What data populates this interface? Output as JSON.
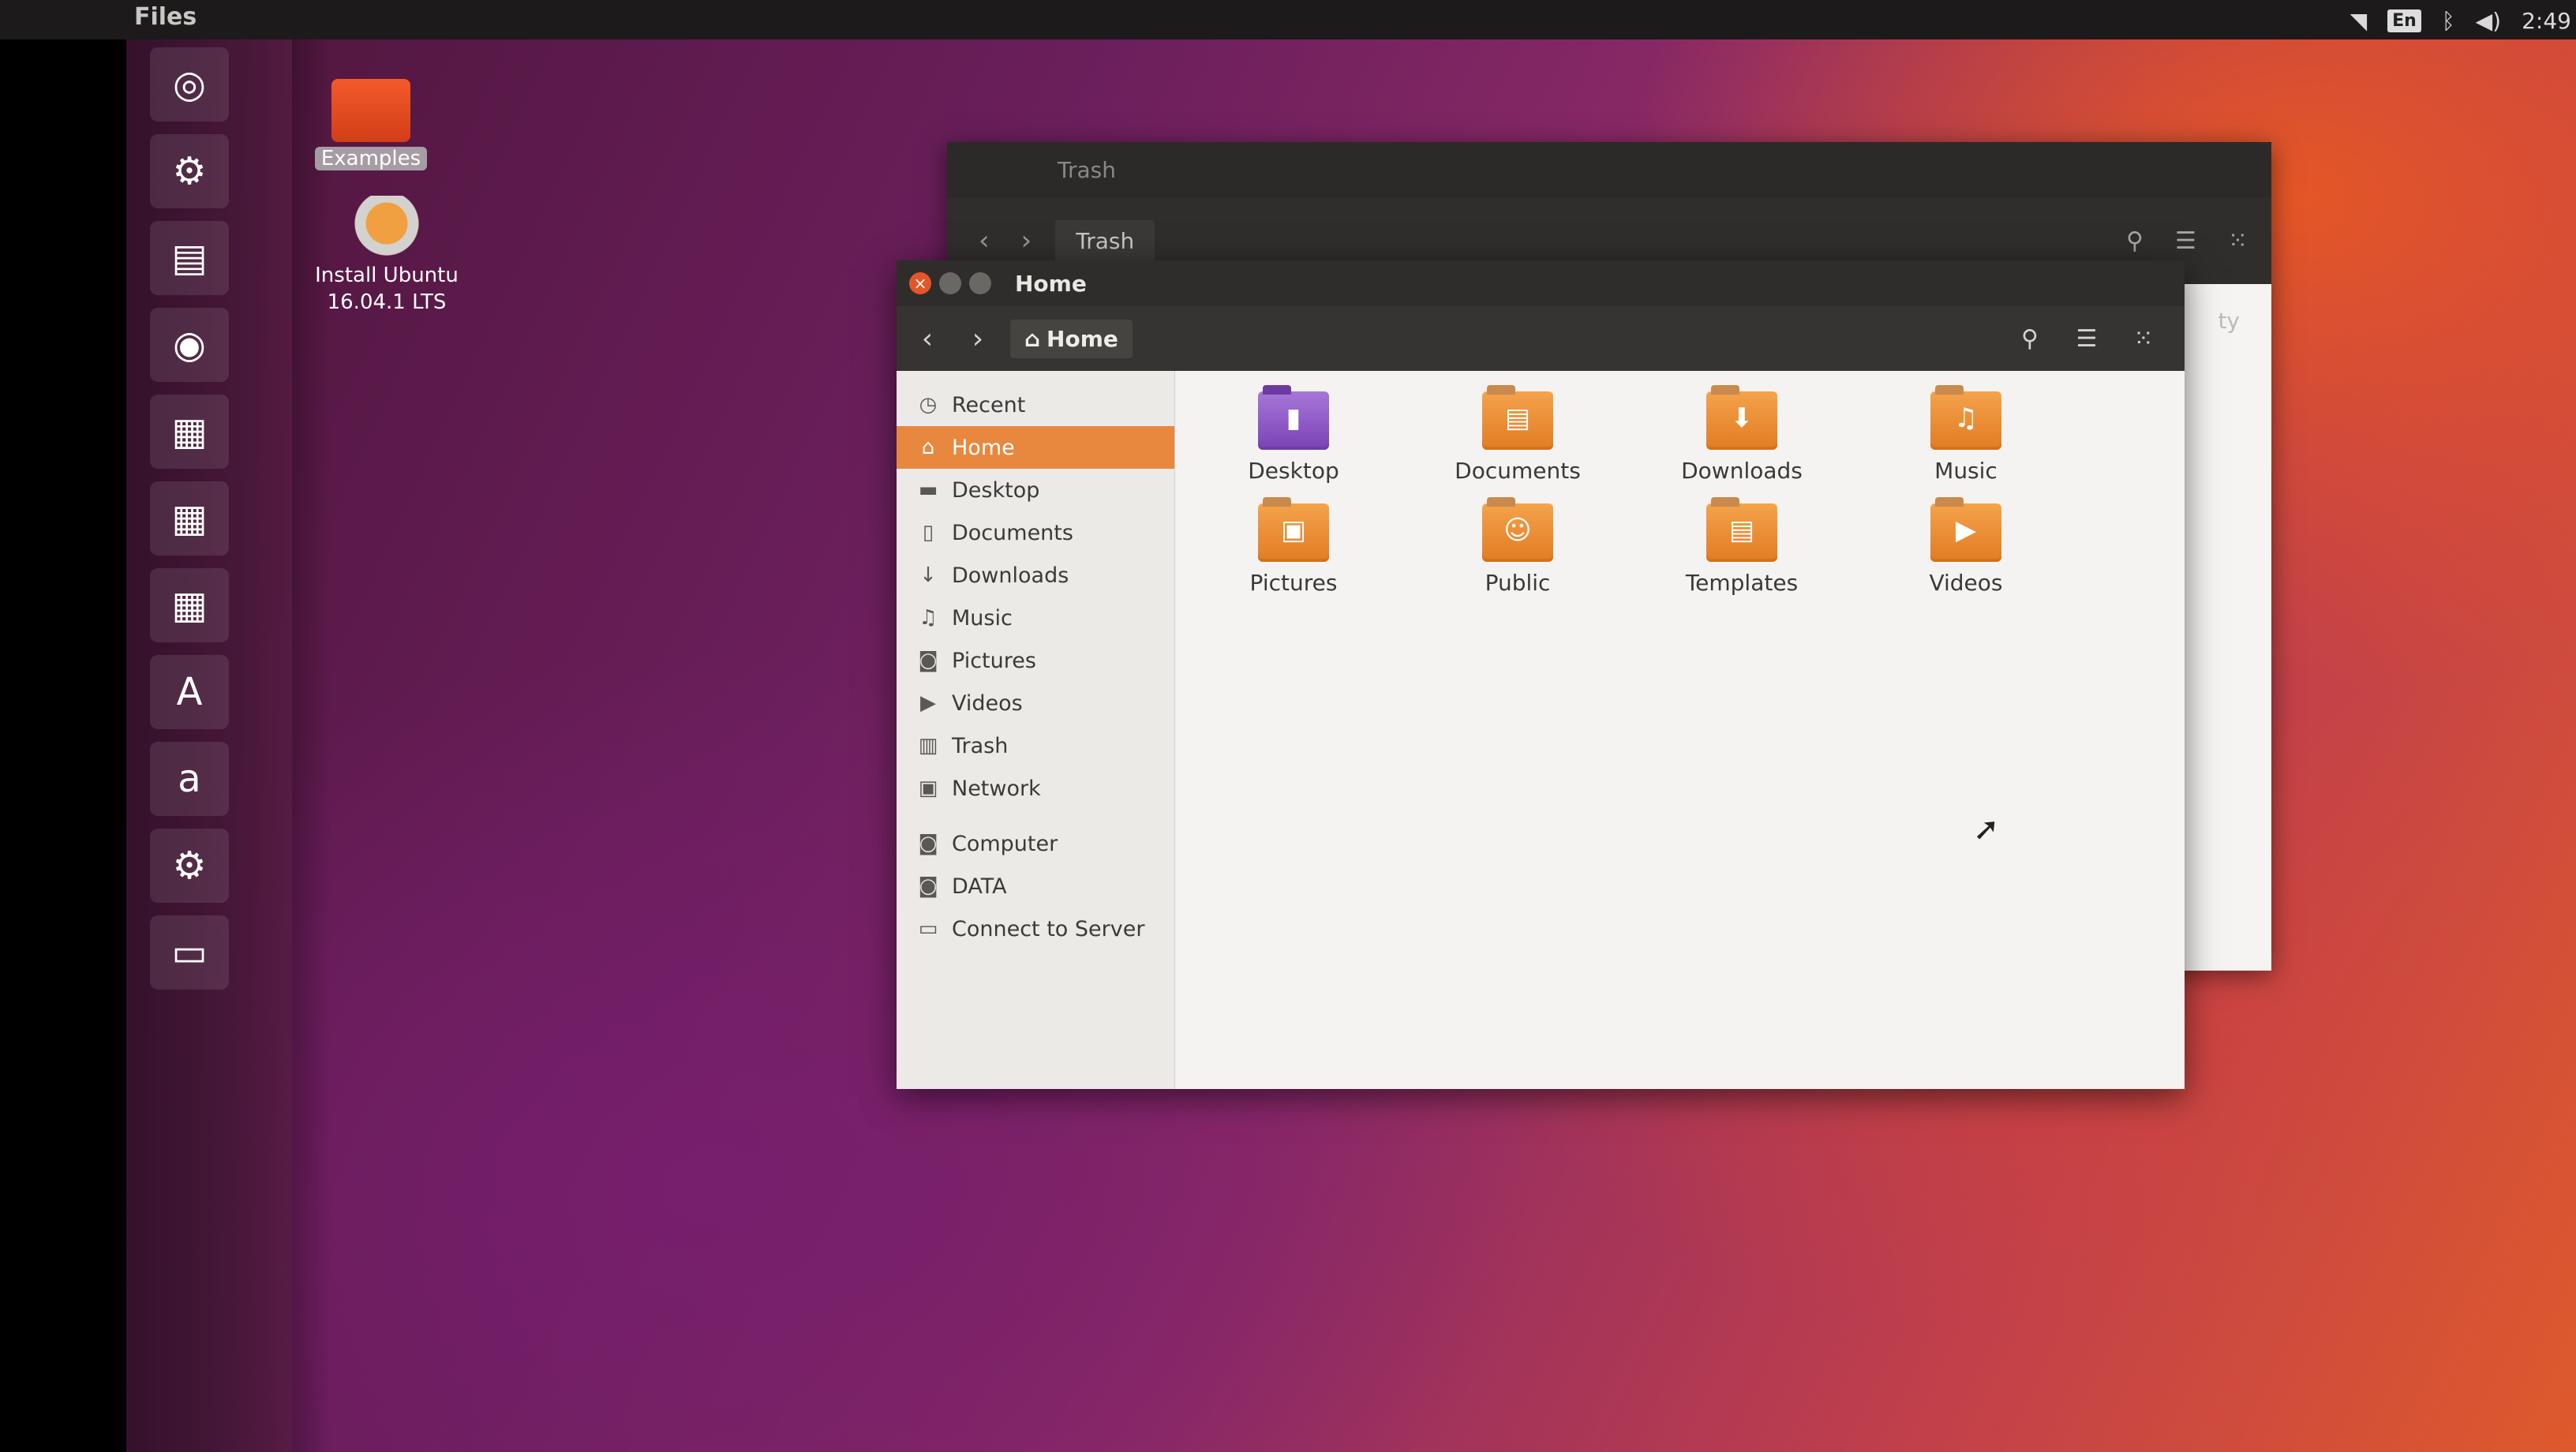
{
  "top_panel": {
    "app_title": "Files",
    "tray": {
      "wifi_icon": "wifi-icon",
      "keyboard_layout": "En",
      "bluetooth_icon": "bluetooth-icon",
      "volume_icon": "volume-icon",
      "clock": "2:49"
    }
  },
  "launcher": {
    "items": [
      {
        "name": "dash-home",
        "glyph": "◎"
      },
      {
        "name": "install-ubuntu",
        "glyph": "⚙"
      },
      {
        "name": "files",
        "glyph": "▤"
      },
      {
        "name": "firefox",
        "glyph": "◉"
      },
      {
        "name": "libreoffice-writer",
        "glyph": "▦"
      },
      {
        "name": "libreoffice-calc",
        "glyph": "▦"
      },
      {
        "name": "libreoffice-impress",
        "glyph": "▦"
      },
      {
        "name": "ubuntu-software",
        "glyph": "A"
      },
      {
        "name": "amazon",
        "glyph": "a"
      },
      {
        "name": "system-settings",
        "glyph": "⚙"
      },
      {
        "name": "drive",
        "glyph": "▭"
      }
    ]
  },
  "desktop": {
    "icons": [
      {
        "label": "Examples",
        "selected": true
      },
      {
        "label": "Install Ubuntu\n16.04.1 LTS",
        "selected": false
      }
    ]
  },
  "trash_window": {
    "title": "Trash",
    "breadcrumb": "Trash",
    "empty_button_partial": "ty"
  },
  "home_window": {
    "title": "Home",
    "breadcrumb": "Home",
    "sidebar": [
      {
        "label": "Recent",
        "icon": "clock-icon",
        "glyph": "◷"
      },
      {
        "label": "Home",
        "icon": "home-icon",
        "glyph": "⌂",
        "active": true
      },
      {
        "label": "Desktop",
        "icon": "desktop-icon",
        "glyph": "▬"
      },
      {
        "label": "Documents",
        "icon": "document-icon",
        "glyph": "▯"
      },
      {
        "label": "Downloads",
        "icon": "download-icon",
        "glyph": "↓"
      },
      {
        "label": "Music",
        "icon": "music-icon",
        "glyph": "♫"
      },
      {
        "label": "Pictures",
        "icon": "camera-icon",
        "glyph": "◙"
      },
      {
        "label": "Videos",
        "icon": "video-icon",
        "glyph": "▶"
      },
      {
        "label": "Trash",
        "icon": "trash-icon",
        "glyph": "▥"
      },
      {
        "label": "Network",
        "icon": "network-icon",
        "glyph": "▣"
      },
      {
        "label": "Computer",
        "icon": "computer-icon",
        "glyph": "◙"
      },
      {
        "label": "DATA",
        "icon": "drive-icon",
        "glyph": "◙"
      },
      {
        "label": "Connect to Server",
        "icon": "server-icon",
        "glyph": "▭"
      }
    ],
    "folders": [
      {
        "label": "Desktop",
        "emblem": "▮",
        "style": "purple"
      },
      {
        "label": "Documents",
        "emblem": "▤"
      },
      {
        "label": "Downloads",
        "emblem": "⬇"
      },
      {
        "label": "Music",
        "emblem": "♫"
      },
      {
        "label": "Pictures",
        "emblem": "▣"
      },
      {
        "label": "Public",
        "emblem": "☺"
      },
      {
        "label": "Templates",
        "emblem": "▤"
      },
      {
        "label": "Videos",
        "emblem": "▶"
      }
    ]
  }
}
